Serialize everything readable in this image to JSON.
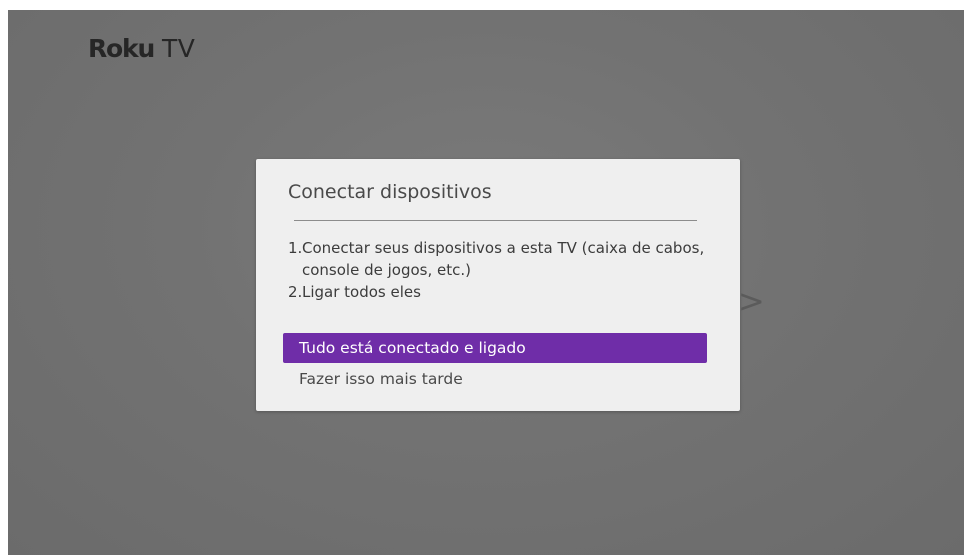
{
  "brand": {
    "name": "Roku",
    "suffix": "TV"
  },
  "background": {
    "chevron_glyph": ">",
    "chevron_icon": "chevron-right-icon"
  },
  "dialog": {
    "title": "Conectar dispositivos",
    "steps": [
      {
        "number": "1.",
        "text": "Conectar seus dispositivos a esta TV (caixa de cabos, console de jogos, etc.)"
      },
      {
        "number": "2.",
        "text": "Ligar todos eles"
      }
    ],
    "options": [
      {
        "label": "Tudo está conectado e ligado",
        "selected": true
      },
      {
        "label": "Fazer isso mais tarde",
        "selected": false
      }
    ]
  },
  "colors": {
    "screen_background": "#727272",
    "dialog_background": "#efefef",
    "selection_purple": "#6f2da8",
    "logo": "#262626"
  }
}
